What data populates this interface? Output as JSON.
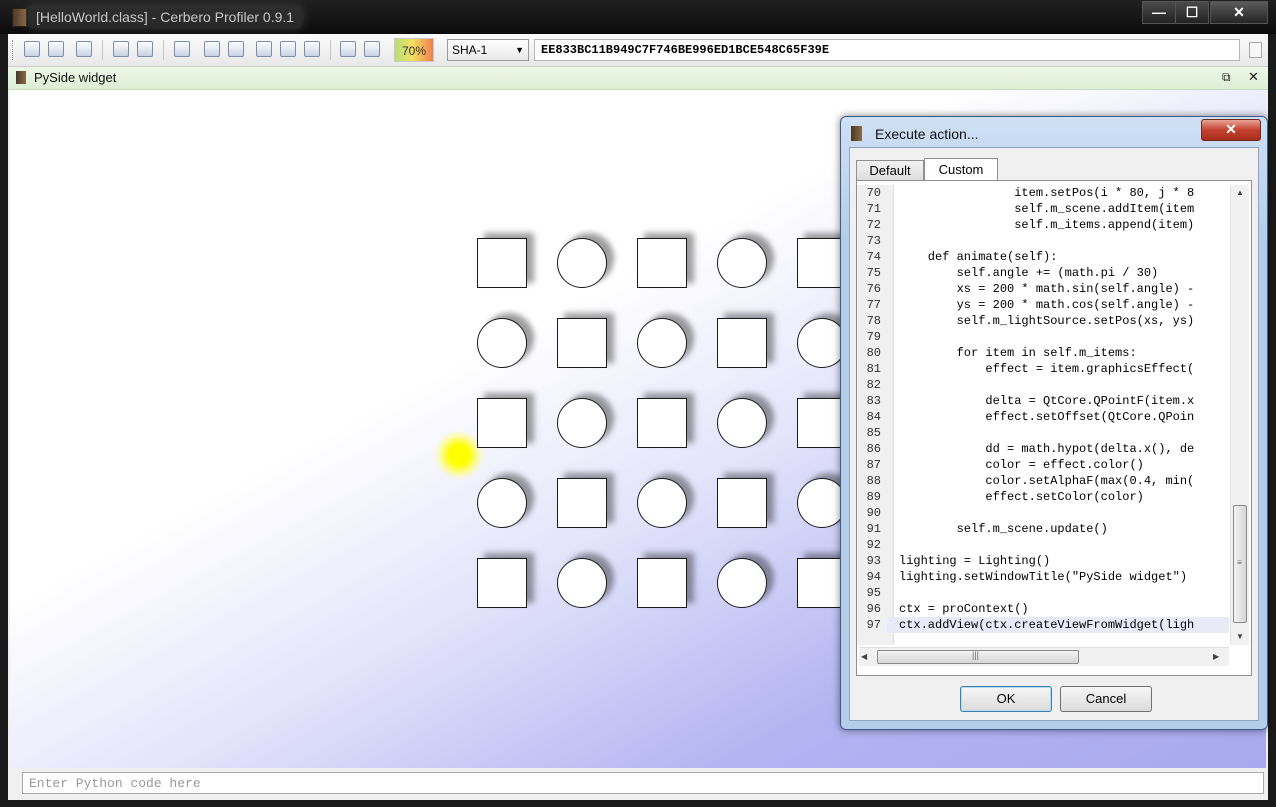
{
  "window": {
    "title": "[HelloWorld.class] - Cerbero Profiler 0.9.1",
    "minimize": "—",
    "maximize": "☐",
    "close": "✕"
  },
  "toolbar": {
    "zoom": "70%",
    "hash_algorithm": "SHA-1",
    "hash_value": "EE833BC11B949C7F746BE996ED1BCE548C65F39E"
  },
  "widget": {
    "title": "PySide widget",
    "float_glyph": "⧉",
    "close_glyph": "✕",
    "grid": [
      [
        "square",
        "circle",
        "square",
        "circle",
        "square"
      ],
      [
        "circle",
        "square",
        "circle",
        "square",
        "circle"
      ],
      [
        "square",
        "circle",
        "square",
        "circle",
        "square"
      ],
      [
        "circle",
        "square",
        "circle",
        "square",
        "circle"
      ],
      [
        "square",
        "circle",
        "square",
        "circle",
        "square"
      ]
    ]
  },
  "python_input": {
    "placeholder": "Enter Python code here"
  },
  "dialog": {
    "title": "Execute action...",
    "close_glyph": "✕",
    "tabs": [
      {
        "label": "Default"
      },
      {
        "label": "Custom"
      }
    ],
    "code_lines": [
      {
        "n": "70",
        "text": "                item.setPos(i * 80, j * 8"
      },
      {
        "n": "71",
        "text": "                self.m_scene.addItem(item"
      },
      {
        "n": "72",
        "text": "                self.m_items.append(item)"
      },
      {
        "n": "73",
        "text": ""
      },
      {
        "n": "74",
        "text": "    def animate(self):"
      },
      {
        "n": "75",
        "text": "        self.angle += (math.pi / 30)"
      },
      {
        "n": "76",
        "text": "        xs = 200 * math.sin(self.angle) -"
      },
      {
        "n": "77",
        "text": "        ys = 200 * math.cos(self.angle) -"
      },
      {
        "n": "78",
        "text": "        self.m_lightSource.setPos(xs, ys)"
      },
      {
        "n": "79",
        "text": ""
      },
      {
        "n": "80",
        "text": "        for item in self.m_items:"
      },
      {
        "n": "81",
        "text": "            effect = item.graphicsEffect("
      },
      {
        "n": "82",
        "text": ""
      },
      {
        "n": "83",
        "text": "            delta = QtCore.QPointF(item.x"
      },
      {
        "n": "84",
        "text": "            effect.setOffset(QtCore.QPoin"
      },
      {
        "n": "85",
        "text": ""
      },
      {
        "n": "86",
        "text": "            dd = math.hypot(delta.x(), de"
      },
      {
        "n": "87",
        "text": "            color = effect.color()"
      },
      {
        "n": "88",
        "text": "            color.setAlphaF(max(0.4, min("
      },
      {
        "n": "89",
        "text": "            effect.setColor(color)"
      },
      {
        "n": "90",
        "text": ""
      },
      {
        "n": "91",
        "text": "        self.m_scene.update()"
      },
      {
        "n": "92",
        "text": ""
      },
      {
        "n": "93",
        "text": "lighting = Lighting()"
      },
      {
        "n": "94",
        "text": "lighting.setWindowTitle(\"PySide widget\")"
      },
      {
        "n": "95",
        "text": ""
      },
      {
        "n": "96",
        "text": "ctx = proContext()"
      },
      {
        "n": "97",
        "text": "ctx.addView(ctx.createViewFromWidget(ligh"
      }
    ],
    "ok_label": "OK",
    "cancel_label": "Cancel"
  }
}
